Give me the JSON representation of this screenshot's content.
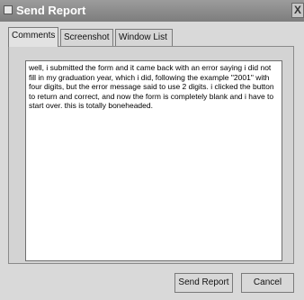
{
  "window": {
    "title": "Send Report",
    "close_label": "X"
  },
  "tabs": [
    {
      "label": "Comments",
      "active": true
    },
    {
      "label": "Screenshot",
      "active": false
    },
    {
      "label": "Window List",
      "active": false
    }
  ],
  "comments": {
    "text": "well, i submitted the form and it came back with an error saying i did not fill in my graduation year, which i did, following the example \"2001\" with four digits, but the error message said to use 2 digits. i clicked the button to return and correct, and now the form is completely blank and i have to start over.  this is totally boneheaded."
  },
  "buttons": {
    "send_label": "Send Report",
    "cancel_label": "Cancel"
  },
  "icons": {
    "app": "app-icon",
    "close": "close-icon"
  }
}
